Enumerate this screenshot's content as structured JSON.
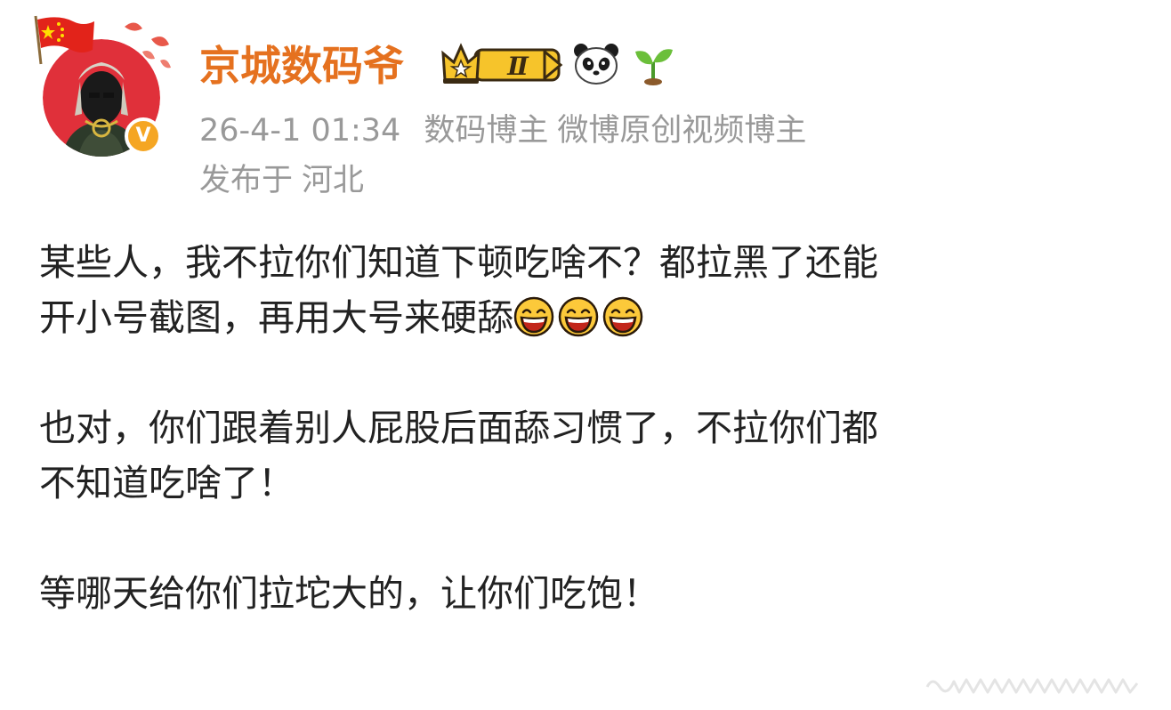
{
  "user": {
    "name": "京城数码爷",
    "badge_level": "Ⅱ"
  },
  "meta": {
    "timestamp": "26-4-1 01:34",
    "tag_1": "数码博主",
    "tag_2": "微博原创视频博主",
    "location_prefix": "发布于",
    "location": "河北"
  },
  "post": {
    "paragraph_1_line_1": "某些人，我不拉你们知道下顿吃啥不？都拉黑了还能",
    "paragraph_1_line_2": "开小号截图，再用大号来硬舔",
    "paragraph_2_line_1": "也对，你们跟着别人屁股后面舔习惯了，不拉你们都",
    "paragraph_2_line_2": "不知道吃啥了！",
    "paragraph_3_line_1": "等哪天给你们拉坨大的，让你们吃饱！"
  },
  "colors": {
    "username": "#e5711f",
    "meta_text": "#999999",
    "body_text": "#222222",
    "verified_badge": "#f5a623"
  },
  "icons": {
    "flag": "china-flag-icon",
    "avatar": "user-avatar",
    "verified": "verified-v-icon",
    "crown": "crown-level-badge-icon",
    "panda": "panda-icon",
    "sprout": "sprout-icon",
    "emoji": "grinning-laugh-emoji"
  }
}
